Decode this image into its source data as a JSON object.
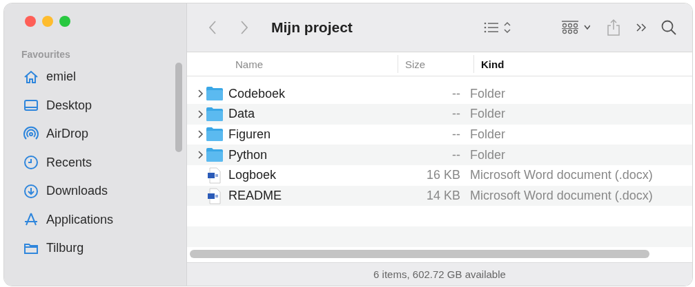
{
  "window": {
    "title": "Mijn project"
  },
  "sidebar": {
    "section": "Favourites",
    "items": [
      {
        "label": "emiel",
        "kind": "home"
      },
      {
        "label": "Desktop",
        "kind": "desktop"
      },
      {
        "label": "AirDrop",
        "kind": "airdrop"
      },
      {
        "label": "Recents",
        "kind": "recents"
      },
      {
        "label": "Downloads",
        "kind": "downloads"
      },
      {
        "label": "Applications",
        "kind": "applications"
      },
      {
        "label": "Tilburg",
        "kind": "folder"
      }
    ]
  },
  "table": {
    "columns": [
      {
        "label": "Name",
        "selected": false
      },
      {
        "label": "Size",
        "selected": false
      },
      {
        "label": "Kind",
        "selected": true
      }
    ],
    "rows": [
      {
        "kind": "folder",
        "name": "Codeboek",
        "size": "--",
        "type": "Folder",
        "expanded": false
      },
      {
        "kind": "folder",
        "name": "Data",
        "size": "--",
        "type": "Folder",
        "expanded": false
      },
      {
        "kind": "folder",
        "name": "Figuren",
        "size": "--",
        "type": "Folder",
        "expanded": false
      },
      {
        "kind": "folder",
        "name": "Python",
        "size": "--",
        "type": "Folder",
        "expanded": false
      },
      {
        "kind": "document",
        "name": "Logboek",
        "size": "16 KB",
        "type": "Microsoft Word document (.docx)"
      },
      {
        "kind": "document",
        "name": "README",
        "size": "14 KB",
        "type": "Microsoft Word document (.docx)"
      }
    ]
  },
  "status_bar": "6 items, 602.72 GB available"
}
